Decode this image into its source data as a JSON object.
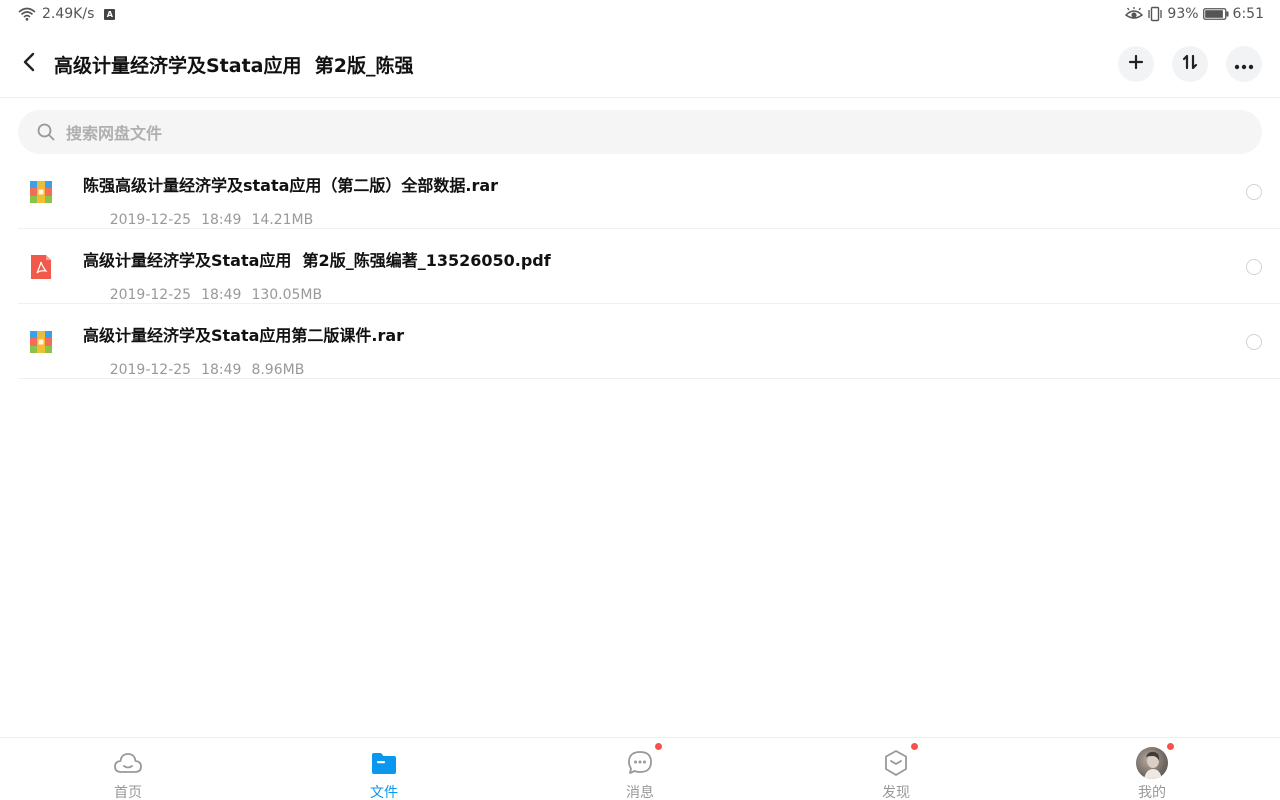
{
  "statusbar": {
    "network_speed": "2.49K/s",
    "battery_percent": "93%",
    "time": "6:51",
    "battery_level": 0.93,
    "left_icons": [
      "wifi-icon",
      "a-badge-icon"
    ],
    "right_icons": [
      "eye-icon",
      "vibrate-icon",
      "battery-icon"
    ]
  },
  "header": {
    "title": "高级计量经济学及Stata应用  第2版_陈强",
    "back_icon": "chevron-left-icon",
    "actions": [
      "plus-icon",
      "sort-icon",
      "more-icon"
    ]
  },
  "search": {
    "placeholder": "搜索网盘文件",
    "icon": "search-icon"
  },
  "files": [
    {
      "name": "陈强高级计量经济学及stata应用（第二版）全部数据.rar",
      "date": "2019-12-25",
      "time": "18:49",
      "size": "14.21MB",
      "type": "archive"
    },
    {
      "name": "高级计量经济学及Stata应用  第2版_陈强编著_13526050.pdf",
      "date": "2019-12-25",
      "time": "18:49",
      "size": "130.05MB",
      "type": "pdf"
    },
    {
      "name": "高级计量经济学及Stata应用第二版课件.rar",
      "date": "2019-12-25",
      "time": "18:49",
      "size": "8.96MB",
      "type": "archive"
    }
  ],
  "nav": [
    {
      "label": "首页",
      "icon": "cloud-icon",
      "active": false,
      "badge": false
    },
    {
      "label": "文件",
      "icon": "folder-icon",
      "active": true,
      "badge": false
    },
    {
      "label": "消息",
      "icon": "message-icon",
      "active": false,
      "badge": true
    },
    {
      "label": "发现",
      "icon": "discover-icon",
      "active": false,
      "badge": true
    },
    {
      "label": "我的",
      "icon": "avatar",
      "active": false,
      "badge": true
    }
  ],
  "colors": {
    "accent": "#0a97ee",
    "badge": "#f4544a",
    "pdf": "#f15a4a",
    "archive_top": "#3aa0e8",
    "archive_mid": "#f06e5a",
    "archive_bottom": "#8bc34a",
    "archive_accent": "#fbc02d"
  }
}
